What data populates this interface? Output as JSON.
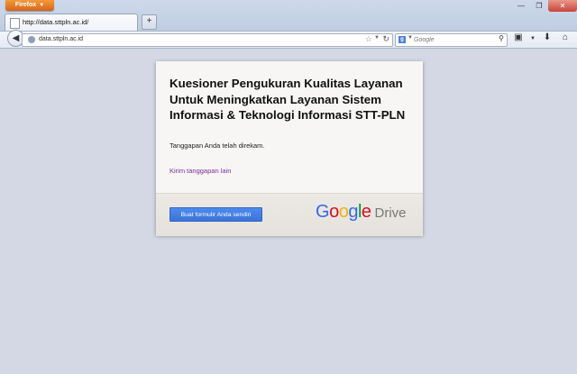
{
  "browser": {
    "menu_button_label": "Firefox",
    "tab_title": "http://data.sttpln.ac.id/",
    "new_tab_label": "+",
    "url": "data.sttpln.ac.id",
    "search_placeholder": "Google"
  },
  "form": {
    "title": "Kuesioner Pengukuran Kualitas Layanan Untuk Meningkatkan Layanan Sistem Informasi & Teknologi Informasi STT-PLN",
    "confirmation": "Tanggapan Anda telah direkam.",
    "submit_another_link": "Kirim tanggapan lain",
    "create_form_button": "Buat formulir Anda sendiri"
  },
  "branding": {
    "google_letters": [
      "G",
      "o",
      "o",
      "g",
      "l",
      "e"
    ],
    "google_colors": [
      "#3369e8",
      "#d50f25",
      "#eeb211",
      "#3369e8",
      "#009925",
      "#d50f25"
    ],
    "drive_word": "Drive"
  },
  "icons": {
    "back": "back-arrow-icon",
    "site": "globe-icon",
    "bookmark": "star-icon",
    "reload": "reload-icon",
    "search": "magnifier-icon",
    "screenshot": "screenshot-icon",
    "download": "download-icon",
    "home": "home-icon"
  },
  "colors": {
    "page_background": "#d3d8e4",
    "button_blue": "#4d8aee",
    "link_purple": "#7b2c9a",
    "firefox_orange": "#e67e22"
  }
}
